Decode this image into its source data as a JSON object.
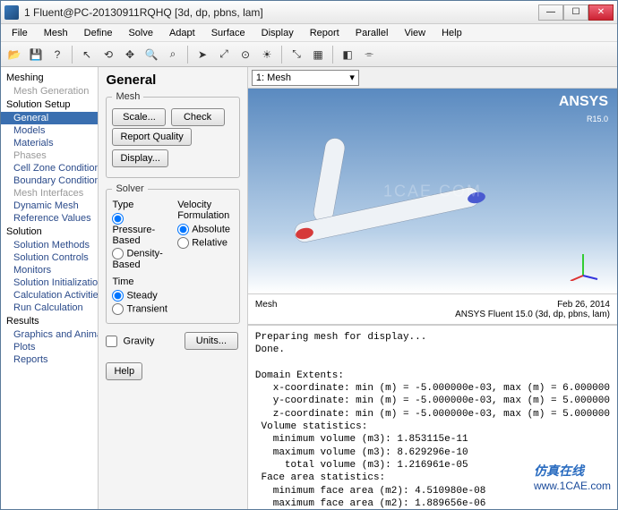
{
  "window": {
    "title": "1 Fluent@PC-20130911RQHQ  [3d, dp, pbns, lam]"
  },
  "menu": [
    "File",
    "Mesh",
    "Define",
    "Solve",
    "Adapt",
    "Surface",
    "Display",
    "Report",
    "Parallel",
    "View",
    "Help"
  ],
  "toolbar_icons": [
    "open-icon",
    "save-icon",
    "help-icon",
    "sep",
    "select-icon",
    "rotate-icon",
    "pan-icon",
    "zoom-icon",
    "zoom-box-icon",
    "sep",
    "arrow-icon",
    "fit-icon",
    "probe-icon",
    "light-icon",
    "sep",
    "ruler-icon",
    "views-icon",
    "sep",
    "scene-icon",
    "camera-icon"
  ],
  "tree": {
    "meshing": {
      "head": "Meshing",
      "items": [
        {
          "label": "Mesh Generation",
          "dis": true
        }
      ]
    },
    "setup": {
      "head": "Solution Setup",
      "items": [
        {
          "label": "General",
          "sel": true
        },
        {
          "label": "Models"
        },
        {
          "label": "Materials"
        },
        {
          "label": "Phases",
          "dis": true
        },
        {
          "label": "Cell Zone Conditions"
        },
        {
          "label": "Boundary Conditions"
        },
        {
          "label": "Mesh Interfaces",
          "dis": true
        },
        {
          "label": "Dynamic Mesh"
        },
        {
          "label": "Reference Values"
        }
      ]
    },
    "solution": {
      "head": "Solution",
      "items": [
        {
          "label": "Solution Methods"
        },
        {
          "label": "Solution Controls"
        },
        {
          "label": "Monitors"
        },
        {
          "label": "Solution Initialization"
        },
        {
          "label": "Calculation Activities"
        },
        {
          "label": "Run Calculation"
        }
      ]
    },
    "results": {
      "head": "Results",
      "items": [
        {
          "label": "Graphics and Animations"
        },
        {
          "label": "Plots"
        },
        {
          "label": "Reports"
        }
      ]
    }
  },
  "task": {
    "title": "General",
    "mesh": {
      "legend": "Mesh",
      "scale": "Scale...",
      "check": "Check",
      "quality": "Report Quality",
      "display": "Display..."
    },
    "solver": {
      "legend": "Solver",
      "type_head": "Type",
      "type_opts": [
        "Pressure-Based",
        "Density-Based"
      ],
      "type_sel": "Pressure-Based",
      "vel_head": "Velocity Formulation",
      "vel_opts": [
        "Absolute",
        "Relative"
      ],
      "vel_sel": "Absolute",
      "time_head": "Time",
      "time_opts": [
        "Steady",
        "Transient"
      ],
      "time_sel": "Steady"
    },
    "gravity": "Gravity",
    "units": "Units...",
    "help": "Help"
  },
  "view": {
    "tab": "1: Mesh",
    "logo": "ANSYS",
    "release": "R15.0",
    "status_left": "Mesh",
    "status_date": "Feb 26, 2014",
    "status_right": "ANSYS Fluent 15.0 (3d, dp, pbns, lam)"
  },
  "console": "Preparing mesh for display...\nDone.\n\nDomain Extents:\n   x-coordinate: min (m) = -5.000000e-03, max (m) = 6.000000\n   y-coordinate: min (m) = -5.000000e-03, max (m) = 5.000000\n   z-coordinate: min (m) = -5.000000e-03, max (m) = 5.000000\n Volume statistics:\n   minimum volume (m3): 1.853115e-11\n   maximum volume (m3): 8.629296e-10\n     total volume (m3): 1.216961e-05\n Face area statistics:\n   minimum face area (m2): 4.510980e-08\n   maximum face area (m2): 1.889656e-06\n Checking mesh.........................",
  "watermark": {
    "center": "1CAE.COM",
    "brand": "仿真在线",
    "url": "www.1CAE.com"
  }
}
